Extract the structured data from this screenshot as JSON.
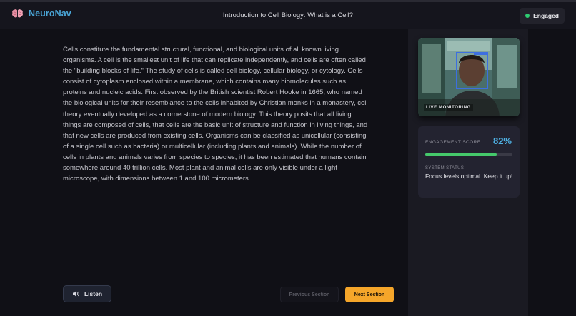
{
  "header": {
    "brand_name": "NeuroNav",
    "lesson_title": "Introduction to Cell Biology: What is a Cell?",
    "status": "Engaged",
    "status_color": "#2ecc71",
    "brand_color": "#4aa6d8"
  },
  "article": {
    "text": "Cells constitute the fundamental structural, functional, and biological units of all known living organisms. A cell is the smallest unit of life that can replicate independently, and cells are often called the \"building blocks of life.\" The study of cells is called cell biology, cellular biology, or cytology. Cells consist of cytoplasm enclosed within a membrane, which contains many biomolecules such as proteins and nucleic acids. First observed by the British scientist Robert Hooke in 1665, who named the biological units for their resemblance to the cells inhabited by Christian monks in a monastery, cell theory eventually developed as a cornerstone of modern biology. This theory posits that all living things are composed of cells, that cells are the basic unit of structure and function in living things, and that new cells are produced from existing cells. Organisms can be classified as unicellular (consisting of a single cell such as bacteria) or multicellular (including plants and animals). While the number of cells in plants and animals varies from species to species, it has been estimated that humans contain somewhere around 40 trillion cells. Most plant and animal cells are only visible under a light microscope, with dimensions between 1 and 100 micrometers."
  },
  "controls": {
    "listen_label": "Listen",
    "listen_icon": "speaker-icon",
    "previous_label": "Previous Section",
    "next_label": "Next Section",
    "next_color": "#f5a62a"
  },
  "sidebar": {
    "camera_label": "LIVE MONITORING",
    "engagement_label": "ENGAGEMENT SCORE",
    "engagement_value": "82%",
    "engagement_fraction": 0.82,
    "engagement_color": "#45c96b",
    "system_status_label": "SYSTEM STATUS",
    "system_status_message": "Focus levels optimal. Keep it up!"
  }
}
